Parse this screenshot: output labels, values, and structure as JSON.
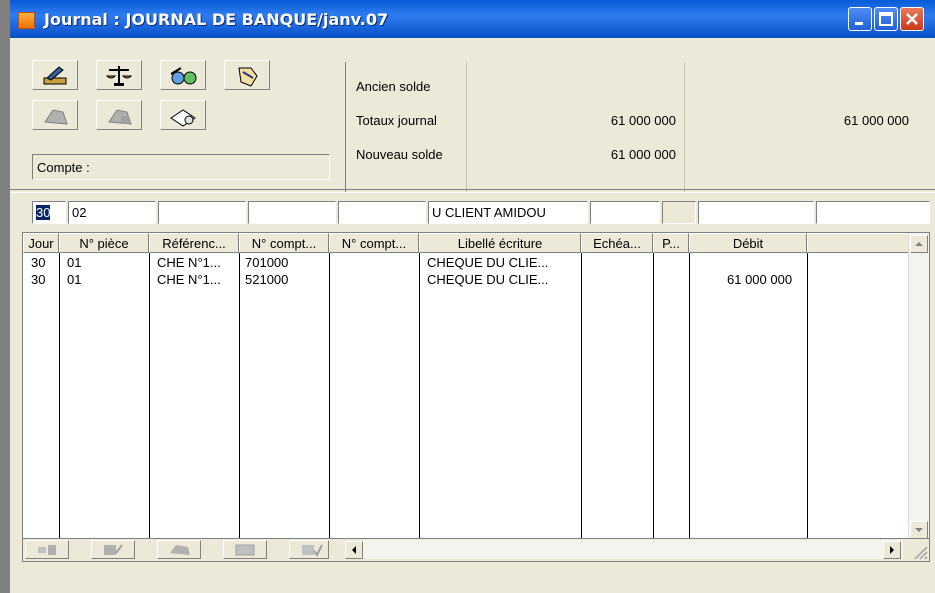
{
  "window": {
    "title": "Journal : JOURNAL DE BANQUE/janv.07"
  },
  "toolbar": {
    "icons": [
      "ruler-edit-icon",
      "balance-scale-icon",
      "glasses-icon",
      "hand-pointer-icon",
      "grey-edit-icon",
      "grey-calculator-icon",
      "envelope-icon"
    ]
  },
  "compte": {
    "label": "Compte :"
  },
  "summary": {
    "ancien_solde": {
      "label": "Ancien solde",
      "v1": "",
      "v2": ""
    },
    "totaux_journal": {
      "label": "Totaux journal",
      "v1": "61 000 000",
      "v2": "61 000 000"
    },
    "nouveau_solde": {
      "label": "Nouveau solde",
      "v1": "61 000 000",
      "v2": ""
    }
  },
  "entry": {
    "jour": "30",
    "piece": "02",
    "reference": "",
    "compte1": "",
    "compte2": "",
    "libelle": "U CLIENT AMIDOU",
    "echeance": "",
    "p": "",
    "debit": "",
    "credit": ""
  },
  "grid": {
    "headers": [
      "Jour",
      "N° pièce",
      "Référenc...",
      "N° compt...",
      "N° compt...",
      "Libellé écriture",
      "Echéa...",
      "P...",
      "Débit",
      ""
    ],
    "rows": [
      {
        "jour": "30",
        "piece": "01",
        "reference": "CHE N°1...",
        "compte1": "701000",
        "compte2": "",
        "libelle": "CHEQUE DU CLIE...",
        "echeance": "",
        "p": "",
        "debit": "",
        "credit": ""
      },
      {
        "jour": "30",
        "piece": "01",
        "reference": "CHE N°1...",
        "compte1": "521000",
        "compte2": "",
        "libelle": "CHEQUE DU CLIE...",
        "echeance": "",
        "p": "",
        "debit": "61 000 000",
        "credit": ""
      }
    ]
  }
}
